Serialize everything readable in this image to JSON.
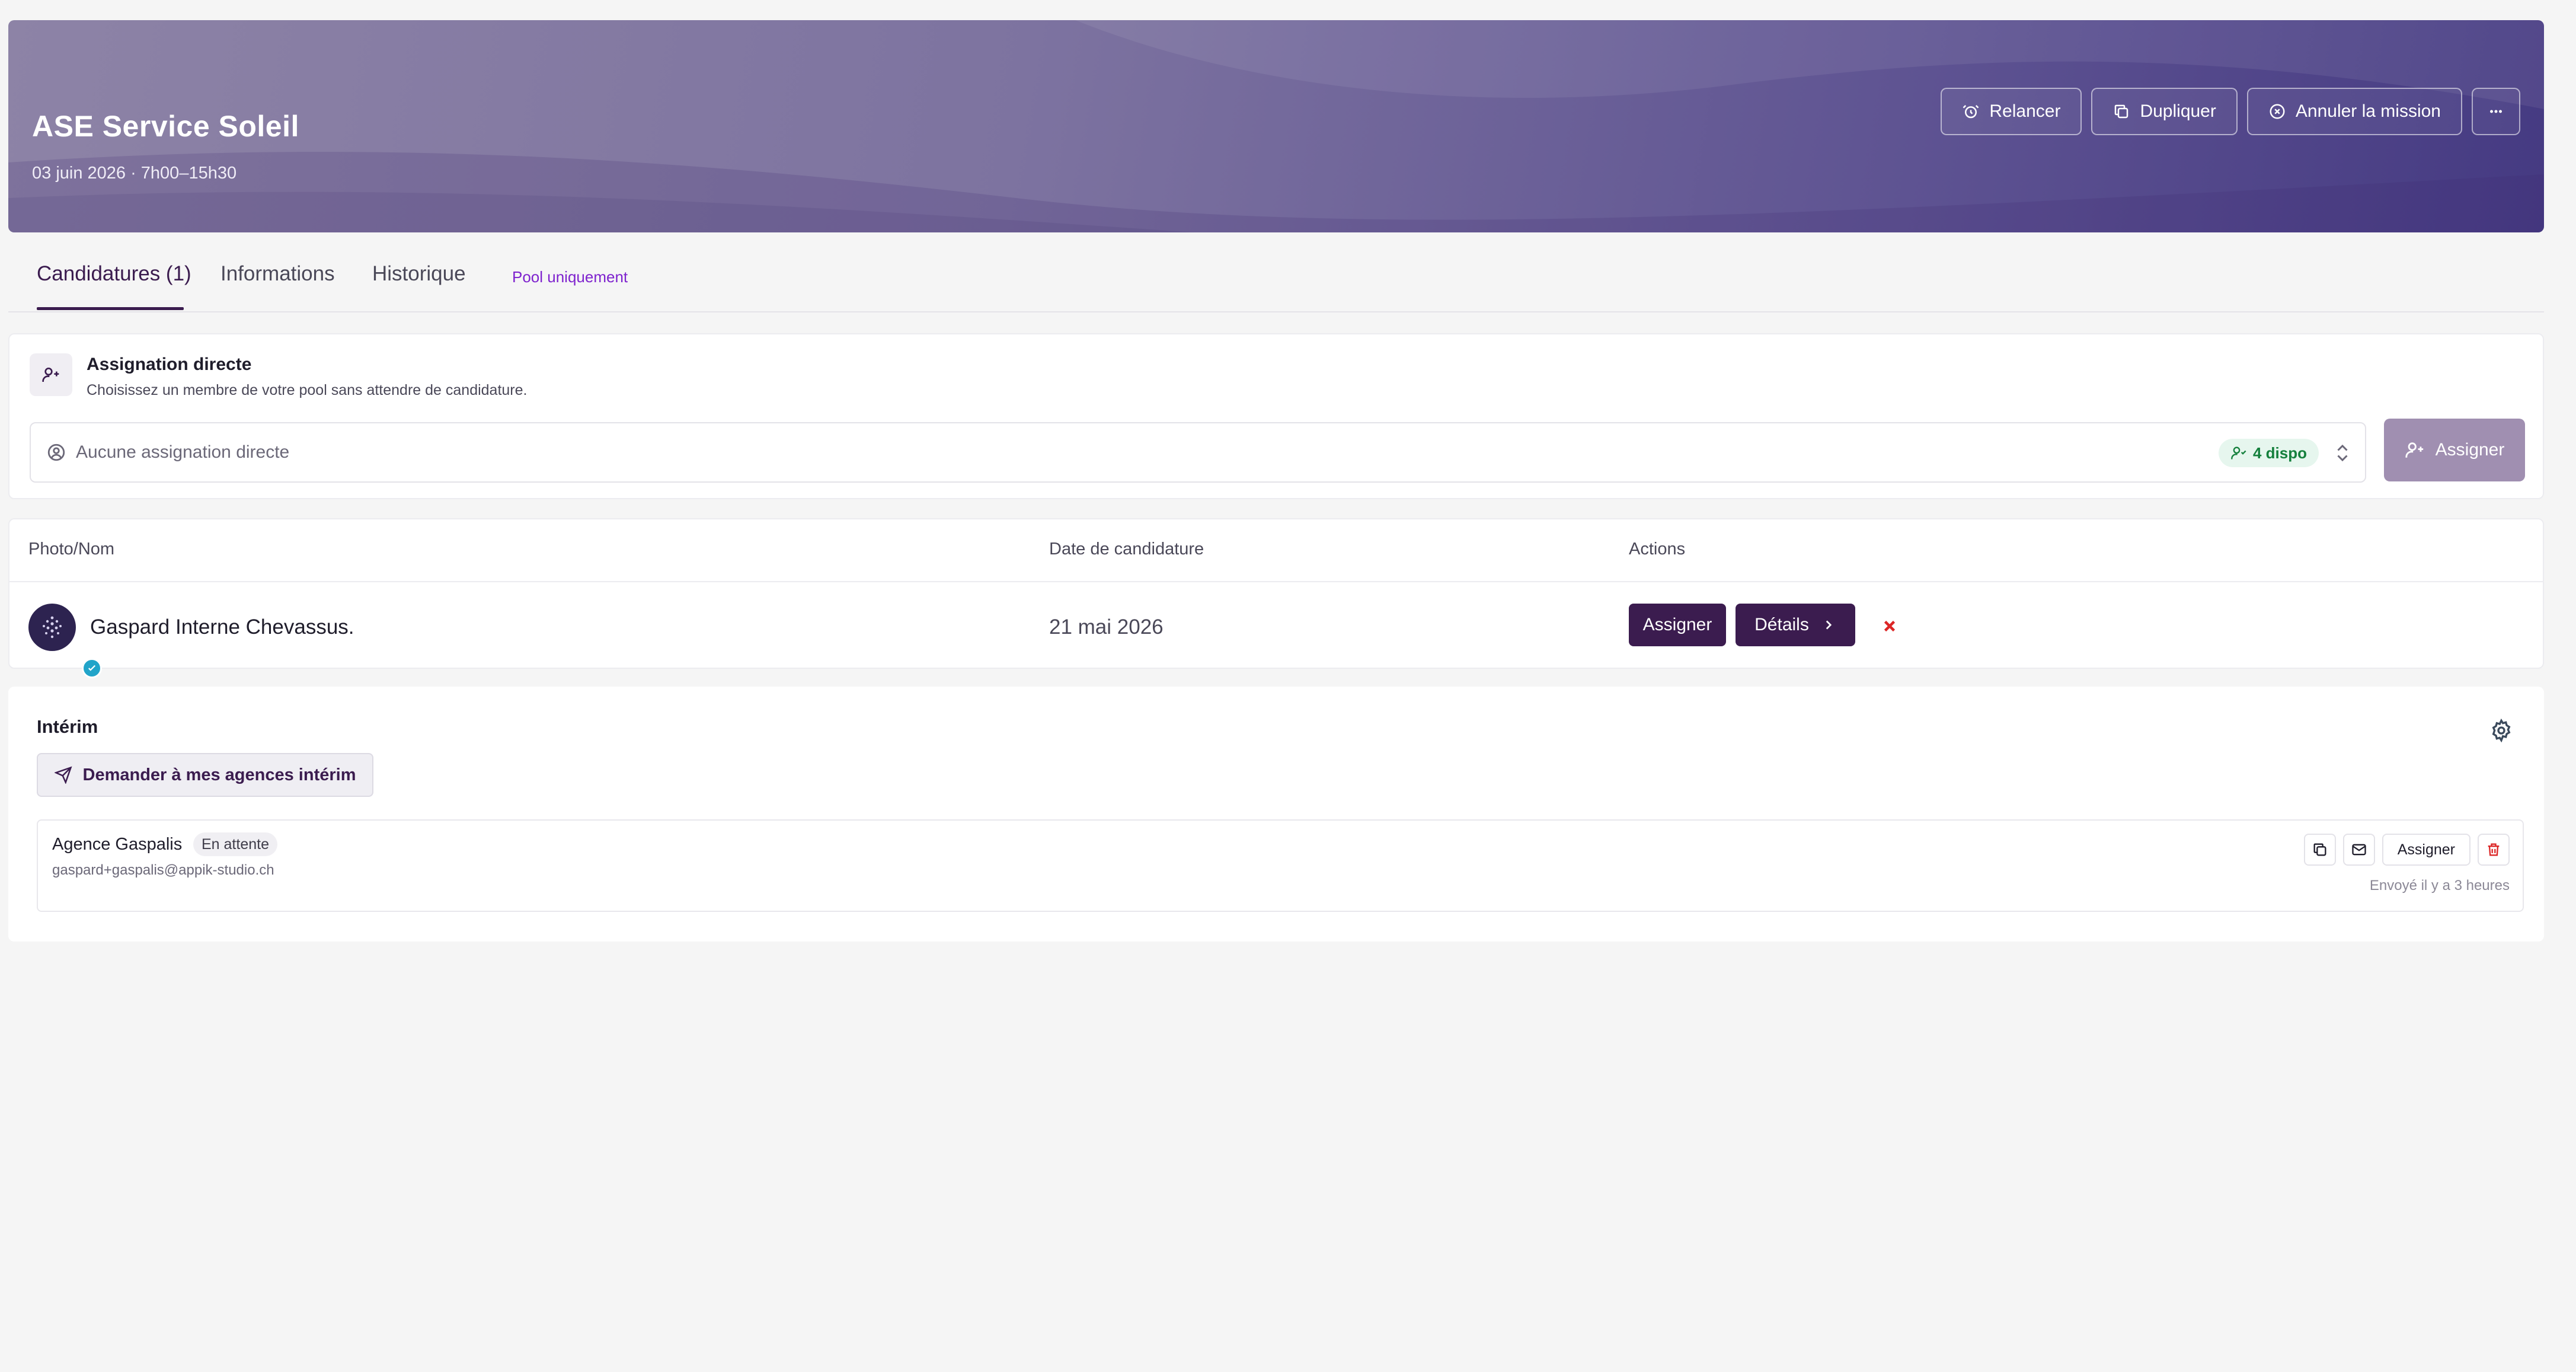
{
  "header": {
    "title": "ASE Service Soleil",
    "subtitle": "03 juin 2026 · 7h00–15h30",
    "actions": {
      "relancer": "Relancer",
      "dupliquer": "Dupliquer",
      "annuler": "Annuler la mission"
    },
    "more_icon": "ellipsis-icon"
  },
  "tabs": {
    "candidatures": "Candidatures (1)",
    "informations": "Informations",
    "historique": "Historique",
    "pool_tag": "Pool uniquement"
  },
  "direct_assignment": {
    "title": "Assignation directe",
    "description": "Choisissez un membre de votre pool sans attendre de candidature.",
    "select_placeholder": "Aucune assignation directe",
    "available_badge": "4 dispo",
    "assign_button": "Assigner"
  },
  "candidates_table": {
    "columns": [
      "Photo/Nom",
      "Date de candidature",
      "Actions"
    ],
    "rows": [
      {
        "name": "Gaspard Interne Chevassus.",
        "date": "21 mai 2026",
        "assign_label": "Assigner",
        "details_label": "Détails"
      }
    ]
  },
  "interim": {
    "title": "Intérim",
    "request_button": "Demander à mes agences intérim",
    "agencies": [
      {
        "name": "Agence Gaspalis",
        "status": "En attente",
        "email": "gaspard+gaspalis@appik-studio.ch",
        "assign_label": "Assigner",
        "sent": "Envoyé il y a 3 heures"
      }
    ]
  },
  "colors": {
    "primary": "#3b1c4f",
    "accent_purple": "#7e22ce",
    "success_green": "#15803d",
    "danger_red": "#dc2626",
    "hero_start": "#8d83a6",
    "hero_end": "#453a82"
  }
}
